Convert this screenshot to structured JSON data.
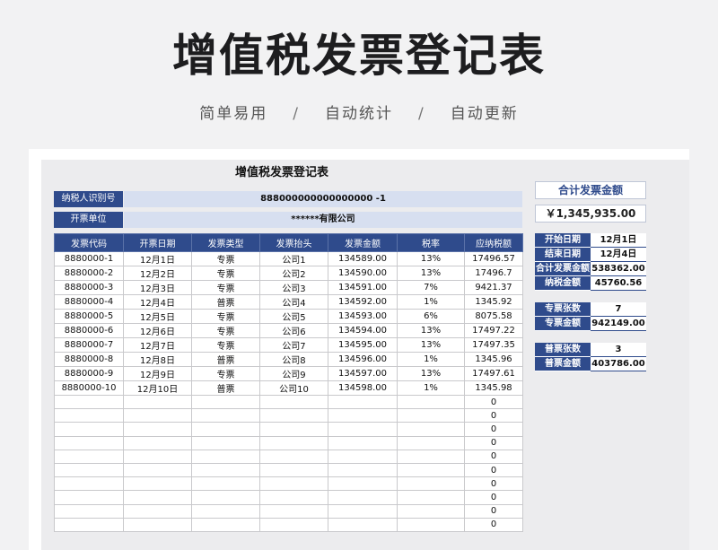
{
  "hero": {
    "title": "增值税发票登记表",
    "tag1": "简单易用",
    "tag2": "自动统计",
    "tag3": "自动更新",
    "separator": "/"
  },
  "sheet": {
    "title": "增值税发票登记表",
    "taxpayer_label": "纳税人识别号",
    "taxpayer_value": "888000000000000000 -1",
    "issuer_label": "开票单位",
    "issuer_value": "******有限公司"
  },
  "table": {
    "headers": [
      "发票代码",
      "开票日期",
      "发票类型",
      "发票抬头",
      "发票金额",
      "税率",
      "应纳税额"
    ],
    "rows": [
      [
        "8880000-1",
        "12月1日",
        "专票",
        "公司1",
        "134589.00",
        "13%",
        "17496.57"
      ],
      [
        "8880000-2",
        "12月2日",
        "专票",
        "公司2",
        "134590.00",
        "13%",
        "17496.7"
      ],
      [
        "8880000-3",
        "12月3日",
        "专票",
        "公司3",
        "134591.00",
        "7%",
        "9421.37"
      ],
      [
        "8880000-4",
        "12月4日",
        "普票",
        "公司4",
        "134592.00",
        "1%",
        "1345.92"
      ],
      [
        "8880000-5",
        "12月5日",
        "专票",
        "公司5",
        "134593.00",
        "6%",
        "8075.58"
      ],
      [
        "8880000-6",
        "12月6日",
        "专票",
        "公司6",
        "134594.00",
        "13%",
        "17497.22"
      ],
      [
        "8880000-7",
        "12月7日",
        "专票",
        "公司7",
        "134595.00",
        "13%",
        "17497.35"
      ],
      [
        "8880000-8",
        "12月8日",
        "普票",
        "公司8",
        "134596.00",
        "1%",
        "1345.96"
      ],
      [
        "8880000-9",
        "12月9日",
        "专票",
        "公司9",
        "134597.00",
        "13%",
        "17497.61"
      ],
      [
        "8880000-10",
        "12月10日",
        "普票",
        "公司10",
        "134598.00",
        "1%",
        "1345.98"
      ],
      [
        "",
        "",
        "",
        "",
        "",
        "",
        "0"
      ],
      [
        "",
        "",
        "",
        "",
        "",
        "",
        "0"
      ],
      [
        "",
        "",
        "",
        "",
        "",
        "",
        "0"
      ],
      [
        "",
        "",
        "",
        "",
        "",
        "",
        "0"
      ],
      [
        "",
        "",
        "",
        "",
        "",
        "",
        "0"
      ],
      [
        "",
        "",
        "",
        "",
        "",
        "",
        "0"
      ],
      [
        "",
        "",
        "",
        "",
        "",
        "",
        "0"
      ],
      [
        "",
        "",
        "",
        "",
        "",
        "",
        "0"
      ],
      [
        "",
        "",
        "",
        "",
        "",
        "",
        "0"
      ],
      [
        "",
        "",
        "",
        "",
        "",
        "",
        "0"
      ]
    ]
  },
  "summary": {
    "total_label": "合计发票金额",
    "total_value": "￥1,345,935.00",
    "group1": [
      {
        "k": "开始日期",
        "v": "12月1日"
      },
      {
        "k": "结束日期",
        "v": "12月4日"
      },
      {
        "k": "合计发票金额",
        "v": "538362.00"
      },
      {
        "k": "纳税金额",
        "v": "45760.56"
      }
    ],
    "group2": [
      {
        "k": "专票张数",
        "v": "7"
      },
      {
        "k": "专票金额",
        "v": "942149.00"
      }
    ],
    "group3": [
      {
        "k": "普票张数",
        "v": "3"
      },
      {
        "k": "普票金额",
        "v": "403786.00"
      }
    ]
  }
}
